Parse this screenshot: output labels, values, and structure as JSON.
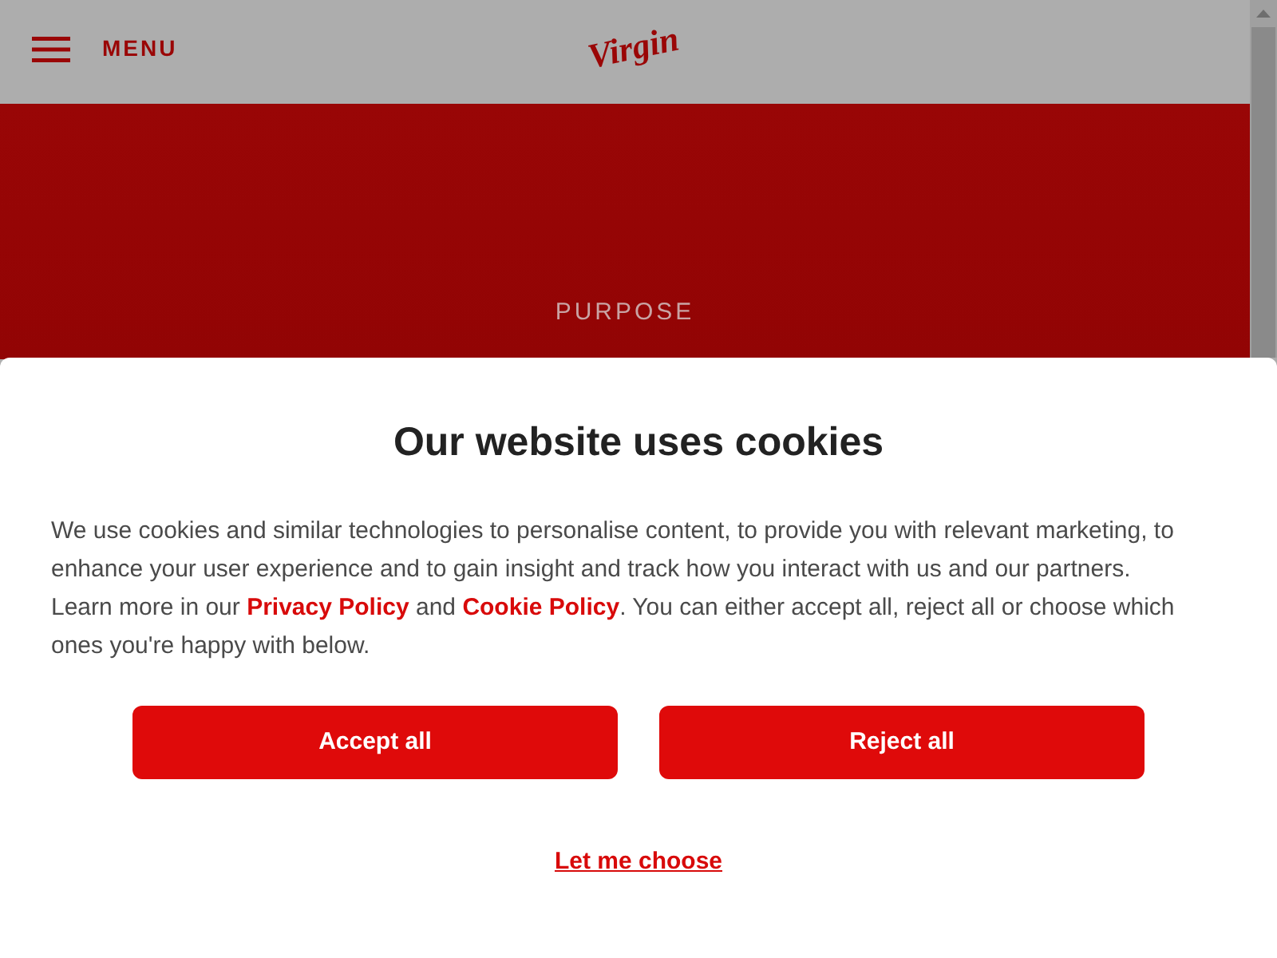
{
  "header": {
    "menu_label": "MENU",
    "logo": "Virgin"
  },
  "hero": {
    "label": "PURPOSE"
  },
  "cookie_dialog": {
    "title": "Our website uses cookies",
    "body": [
      {
        "kind": "text",
        "text": "We use cookies and similar technologies to personalise content, to provide you with relevant marketing, to enhance your user experience and to gain insight and track how you interact with us and our partners. Learn more in our "
      },
      {
        "kind": "link",
        "text": "Privacy Policy"
      },
      {
        "kind": "text",
        "text": " and "
      },
      {
        "kind": "link",
        "text": "Cookie Policy"
      },
      {
        "kind": "text",
        "text": ". You can either accept all, reject all or choose which ones you're happy with below."
      }
    ],
    "buttons": [
      {
        "label": "Accept all"
      },
      {
        "label": "Reject all"
      }
    ],
    "choose_link": "Let me choose"
  }
}
